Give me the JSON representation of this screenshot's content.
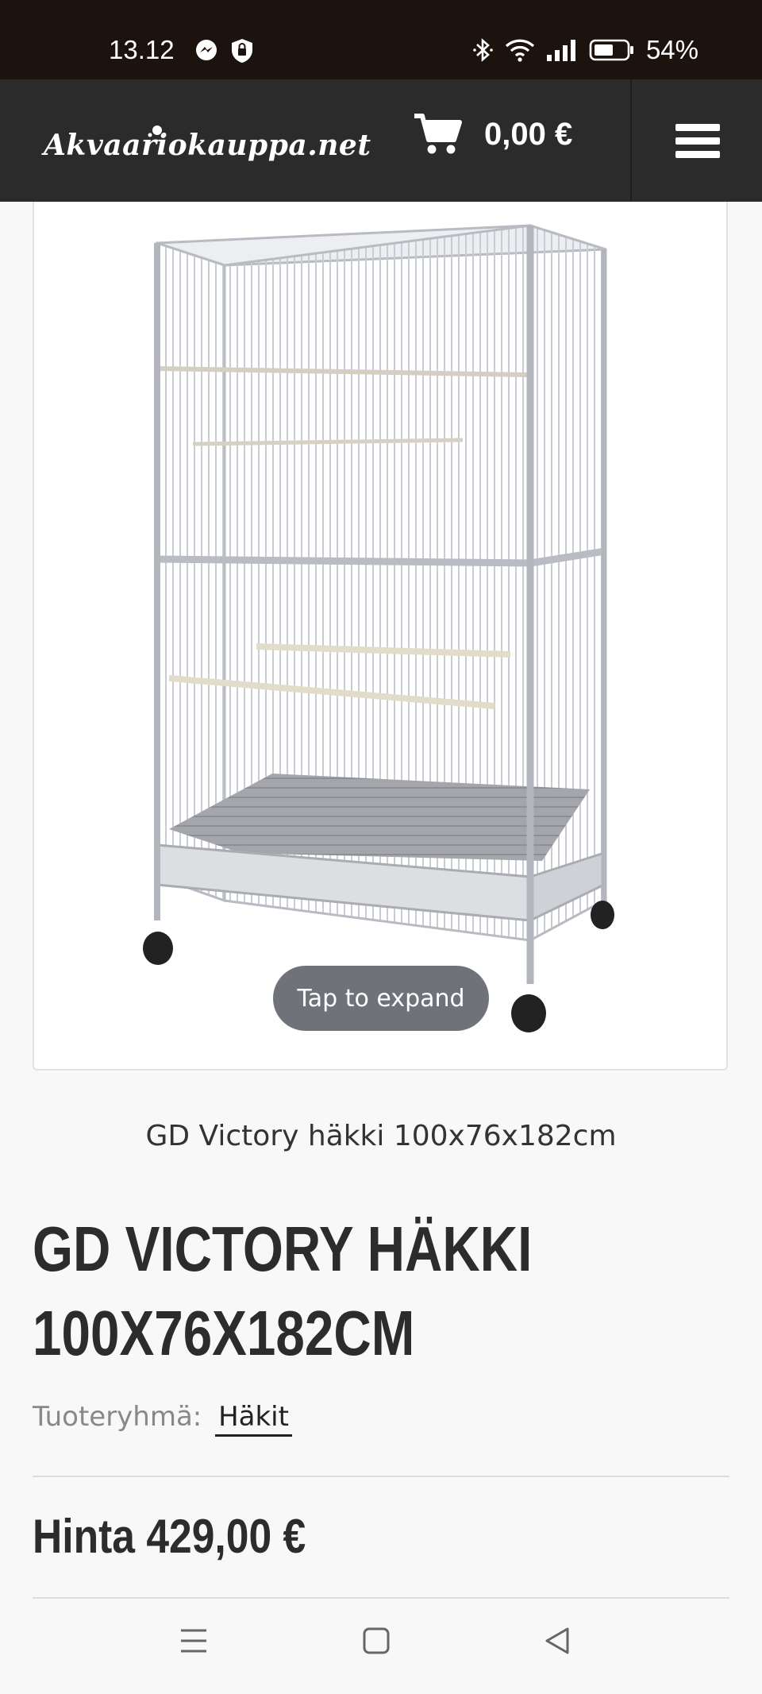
{
  "status_bar": {
    "time": "13.12",
    "battery": "54%"
  },
  "header": {
    "logo": "Akvaariokauppa.net",
    "cart_total": "0,00 €"
  },
  "product": {
    "image_overlay": "Tap to expand",
    "caption": "GD Victory häkki 100x76x182cm",
    "title_line1": "GD Victory häkki",
    "title_line2": "100x76x182cm",
    "group_label": "Tuoteryhmä:",
    "group_link": "Häkit",
    "price": "Hinta 429,00 €"
  },
  "colors": {
    "status_bar": "#1c120e",
    "header": "#2b2b2b",
    "title": "#2c2c2c",
    "overlay_pill": "#6f7279"
  },
  "icons": [
    "messenger-icon",
    "vpn-shield-icon",
    "bluetooth-icon",
    "wifi-icon",
    "signal-icon",
    "battery-icon",
    "cart-icon",
    "hamburger-menu-icon",
    "recent-apps-icon",
    "home-icon",
    "back-icon"
  ]
}
